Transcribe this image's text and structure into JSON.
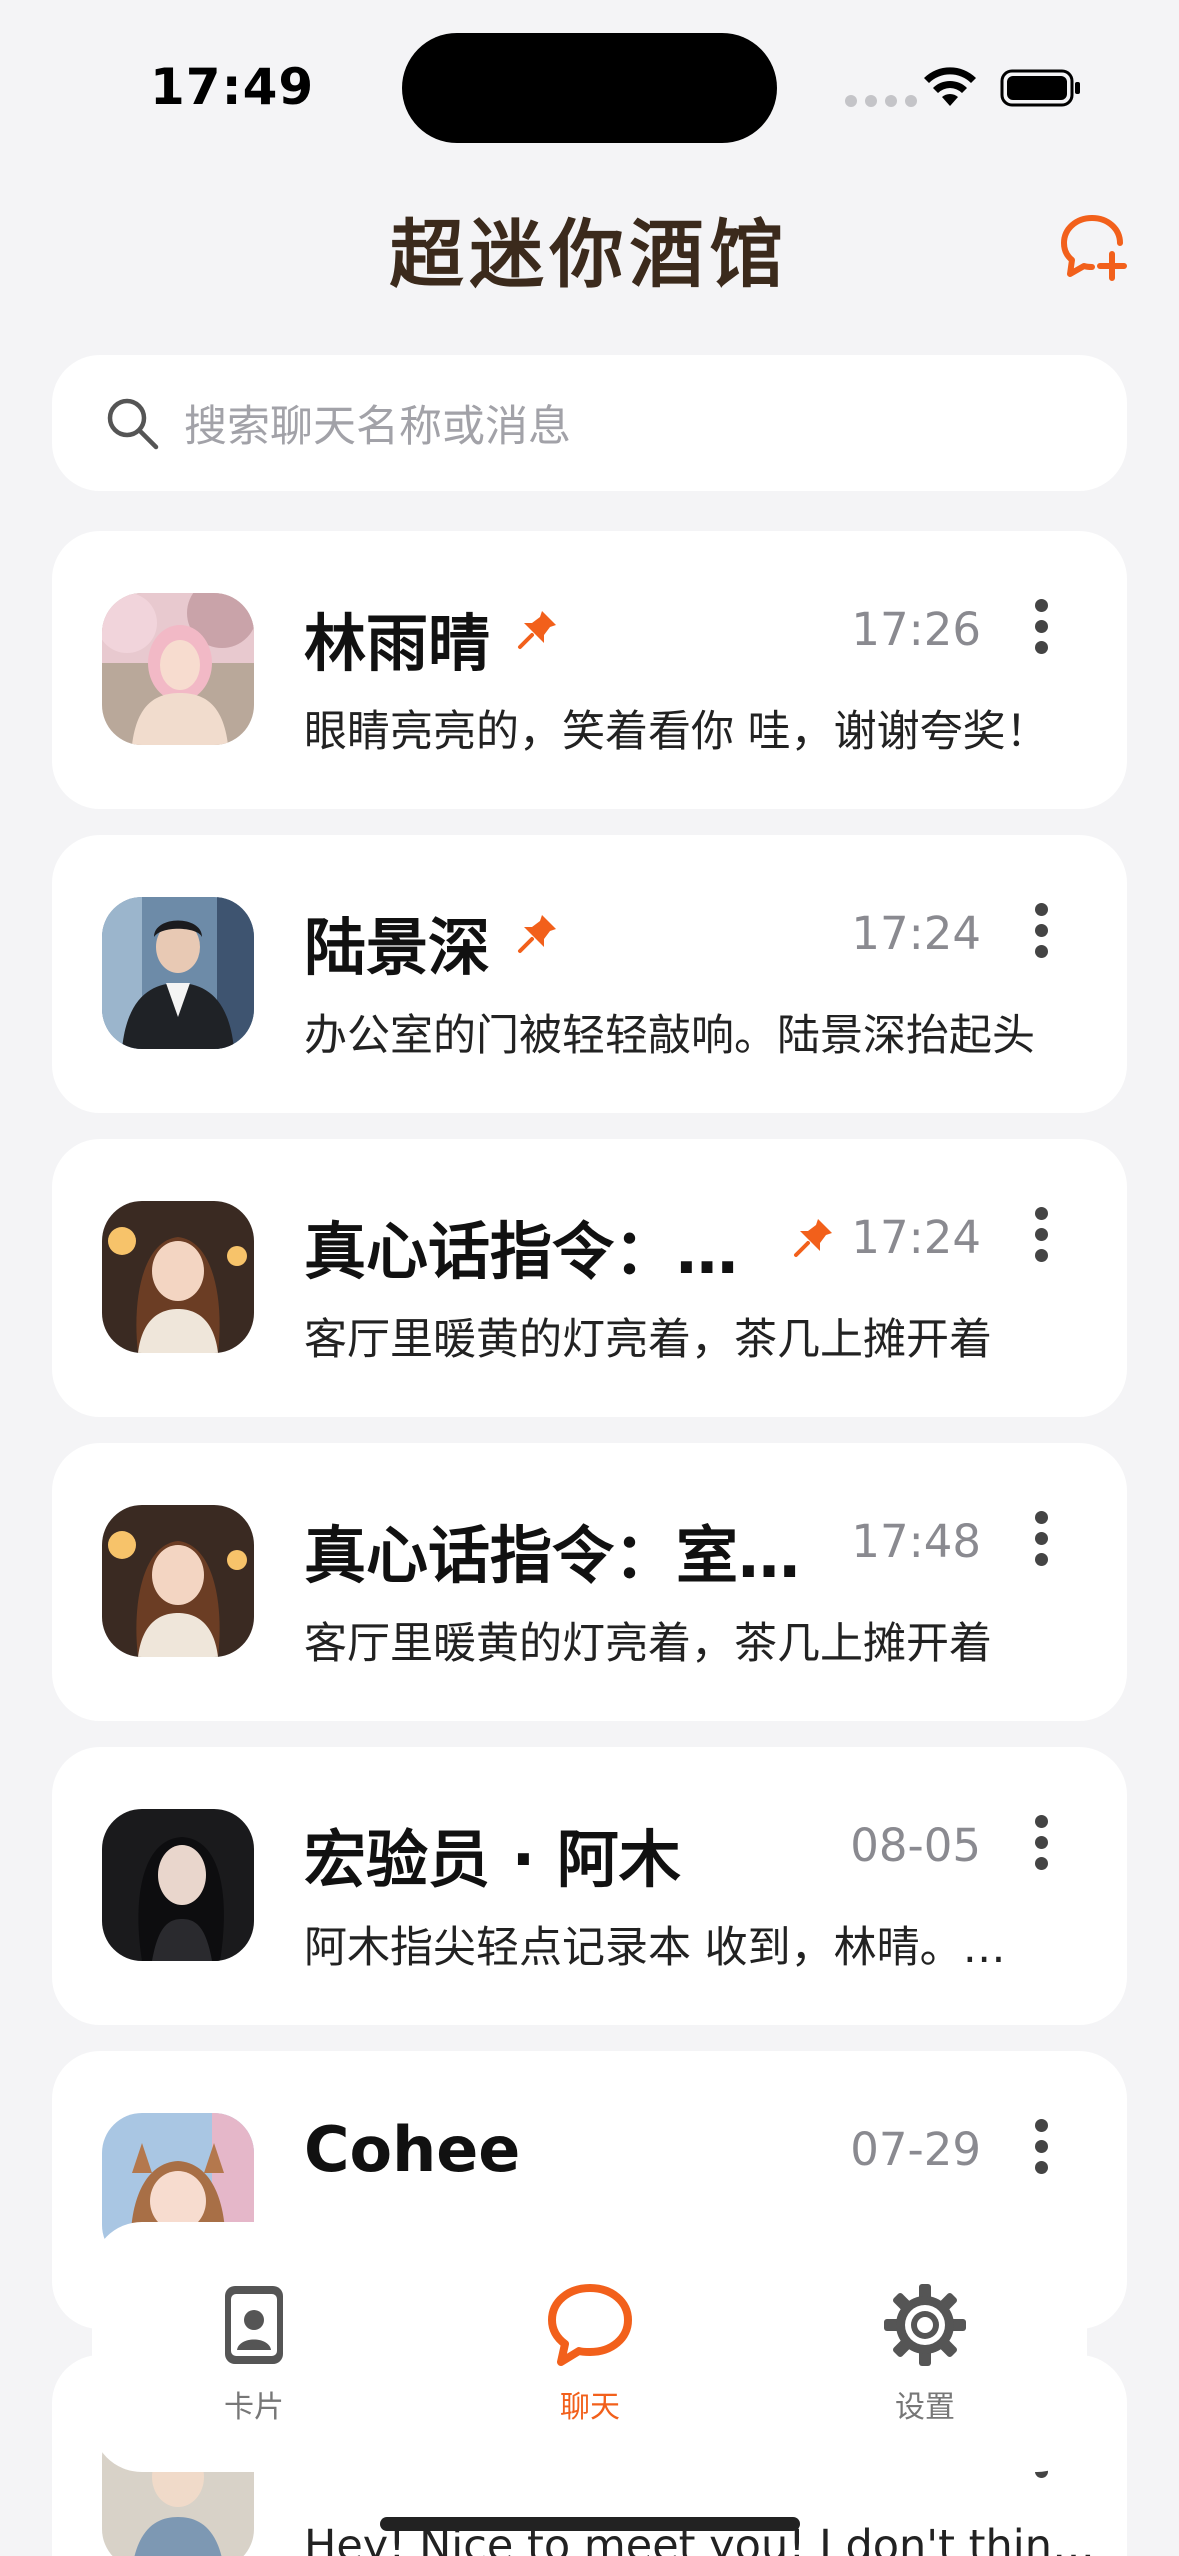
{
  "status_bar": {
    "time": "17:49"
  },
  "header": {
    "title": "超迷你酒馆",
    "new_chat_icon": "chat-plus-icon"
  },
  "search": {
    "placeholder": "搜索聊天名称或消息"
  },
  "colors": {
    "accent": "#f2601b",
    "background": "#f4f4f6",
    "card": "#ffffff"
  },
  "chats": [
    {
      "name": "林雨晴",
      "pinned": true,
      "time": "17:26",
      "preview": "眼睛亮亮的，笑着看你 哇，谢谢夸奖！"
    },
    {
      "name": "陆景深",
      "pinned": true,
      "time": "17:24",
      "preview": "办公室的门被轻轻敲响。陆景深抬起头"
    },
    {
      "name": "真心话指令：…",
      "pinned": true,
      "time": "17:24",
      "preview": "客厅里暖黄的灯亮着，茶几上摊开着"
    },
    {
      "name": "真心话指令：室…",
      "pinned": false,
      "time": "17:48",
      "preview": "客厅里暖黄的灯亮着，茶几上摊开着"
    },
    {
      "name": "宏验员 · 阿木",
      "pinned": false,
      "time": "08-05",
      "preview": "阿木指尖轻点记录本 收到，林晴。…"
    },
    {
      "name": "Cohee",
      "pinned": false,
      "time": "07-29",
      "preview": ""
    },
    {
      "name": "",
      "pinned": false,
      "time": "",
      "preview": "Hey! Nice to meet you! I don't think we've met"
    }
  ],
  "tab_bar": {
    "tabs": [
      {
        "label": "卡片",
        "icon": "id-card-icon",
        "active": false
      },
      {
        "label": "聊天",
        "icon": "chat-bubble-icon",
        "active": true
      },
      {
        "label": "设置",
        "icon": "gear-icon",
        "active": false
      }
    ]
  }
}
